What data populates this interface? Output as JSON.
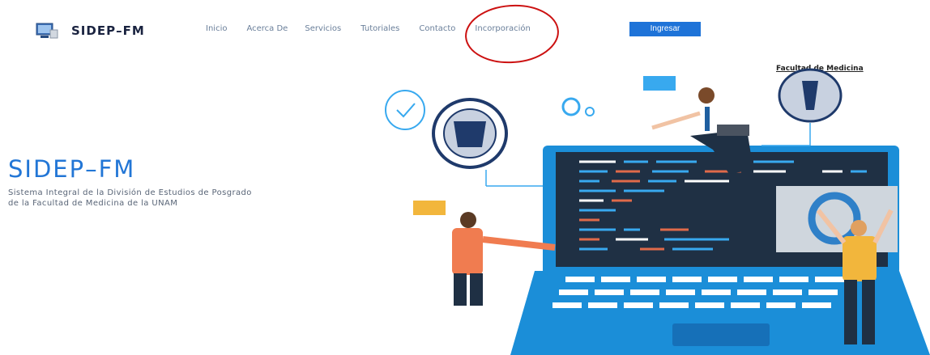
{
  "brand": {
    "name": "SIDEP–FM",
    "logo_icon": "computer-monitor-icon"
  },
  "nav": {
    "items": [
      "Inicio",
      "Acerca De",
      "Servicios",
      "Tutoriales",
      "Contacto",
      "Incorporación"
    ],
    "login_label": "Ingresar"
  },
  "hero": {
    "title": "SIDEP–FM",
    "subtitle_line1": "Sistema Integral de la División de Estudios de Posgrado",
    "subtitle_line2": "de la Facultad de Medicina de la UNAM"
  },
  "illustration": {
    "facultad_label": "Facultad de Medicina",
    "icons": [
      "unam-seal-icon",
      "facultad-medicina-seal-icon",
      "check-circle-icon",
      "gears-icon",
      "laptop-icon"
    ]
  },
  "colors": {
    "accent": "#1e73d8",
    "annotation_circle": "#cc1111",
    "laptop_body": "#1b8ed8",
    "screen": "#1f3044"
  }
}
